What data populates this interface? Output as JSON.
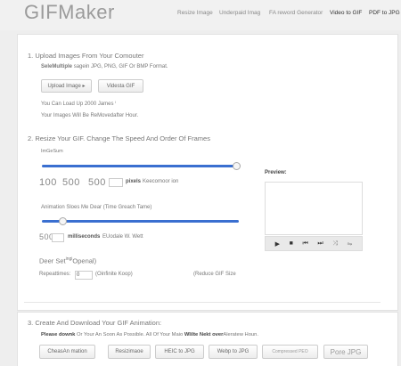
{
  "header": {
    "logo": "GIFMaker",
    "nav": [
      "Resize Image",
      "Underpaid Imag",
      "FA reword Generator",
      "Video to GIF",
      "PDF to JPG"
    ]
  },
  "upload": {
    "title": "1. Upload Images From Your Comouter",
    "select_prefix": "SeleMultiple",
    "select_suffix": "sagein JPG, PNG, GIF Or BMP Format.",
    "btn_upload": "Upload Image",
    "btn_video": "Videsta GIF",
    "load_note": "You Can Load Up 2000 James",
    "removed_note": "Your Images Will Be ReMovedafter Hour."
  },
  "resize": {
    "title": "2. Resize Your GIF. Change The Speed And Order Of Frames",
    "size_label": "ImGeSum",
    "size_value": 100,
    "width": "100",
    "mid": "500",
    "height": "500",
    "pixels_label": "pixels",
    "keep_label": "Keecomoor ion",
    "anim_label": "Animation Sloes Me Dear (Time Greach Tame)",
    "anim_value": 8,
    "ms_value": "500",
    "ms_label": "milliseconds",
    "speed_note": "EUodale W. Wett",
    "order_label": "Deer Set",
    "order_sup": "ingi",
    "order_suffix": "Openal)",
    "repeat_label": "Repeattimes:",
    "repeat_value": "0",
    "infinite_label": "(Oinfinite Koop)",
    "reduce_label": "(Reduce GIF Size",
    "preview_label": "Preview:"
  },
  "download": {
    "title": "3. Create And Download Your GIF Animation:",
    "note_prefix": "Please downk",
    "note_mid": "Or Your An Soon As Possible. All Of Your Maio",
    "note_bold": "Wlilte Nekt",
    "note_over": "over",
    "note_suffix": "Aleratew Houn.",
    "buttons": [
      "CheasAn mation",
      "Resizimaoe",
      "HEIC to JPG",
      "Webp to JPG",
      "Compressed PEO",
      "Pore JPG"
    ]
  }
}
